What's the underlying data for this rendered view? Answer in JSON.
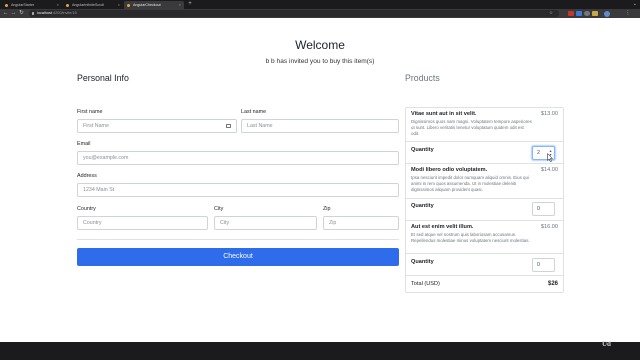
{
  "browser": {
    "tabs": [
      {
        "label": "AngularStarter"
      },
      {
        "label": "AngularInfiniteScroll"
      },
      {
        "label": "AngularCheckout"
      }
    ],
    "url": {
      "host": "localhost",
      "path": ":4200/invite/15"
    }
  },
  "page": {
    "title": "Welcome",
    "subtitle": "b b has invited you to buy this item(s)"
  },
  "personal_info": {
    "heading": "Personal Info",
    "first_name_label": "First name",
    "first_name_placeholder": "First Name",
    "last_name_label": "Last name",
    "last_name_placeholder": "Last Name",
    "email_label": "Email",
    "email_placeholder": "you@example.com",
    "address_label": "Address",
    "address_placeholder": "1234 Main St",
    "country_label": "Country",
    "country_placeholder": "Country",
    "city_label": "City",
    "city_placeholder": "City",
    "zip_label": "Zip",
    "zip_placeholder": "Zip",
    "checkout_label": "Checkout"
  },
  "products": {
    "heading": "Products",
    "quantity_label": "Quantity",
    "items": [
      {
        "name": "Vitae sunt aut in sit velit.",
        "price": "$13.00",
        "description": "Dignissimos quos nam magni. Voluptatem tempore asperiores ut sunt. Libero veritatis tenetur voluptatum quidem odit est odit.",
        "quantity": "2"
      },
      {
        "name": "Modi libero odio voluptatem.",
        "price": "$14.00",
        "description": "Ipsa nesciunt impedit dolor numquam aliquid omnis. Eius qui animi in rem quos assumenda. Ut in molestiae deleniti dignissimos aliquam provident quasi.",
        "quantity": "0"
      },
      {
        "name": "Aut est enim velit illum.",
        "price": "$16.00",
        "description": "Et sed atque vel nostrum quis laboriosam accusamus. Repellendus molestiae minus voluptatem nesciunt molestias.",
        "quantity": "0"
      }
    ],
    "total_label": "Total (USD)",
    "total_value": "$26"
  },
  "colors": {
    "primary_button": "#2f6cec",
    "muted_text": "#6c757d",
    "border": "#ced4da"
  }
}
